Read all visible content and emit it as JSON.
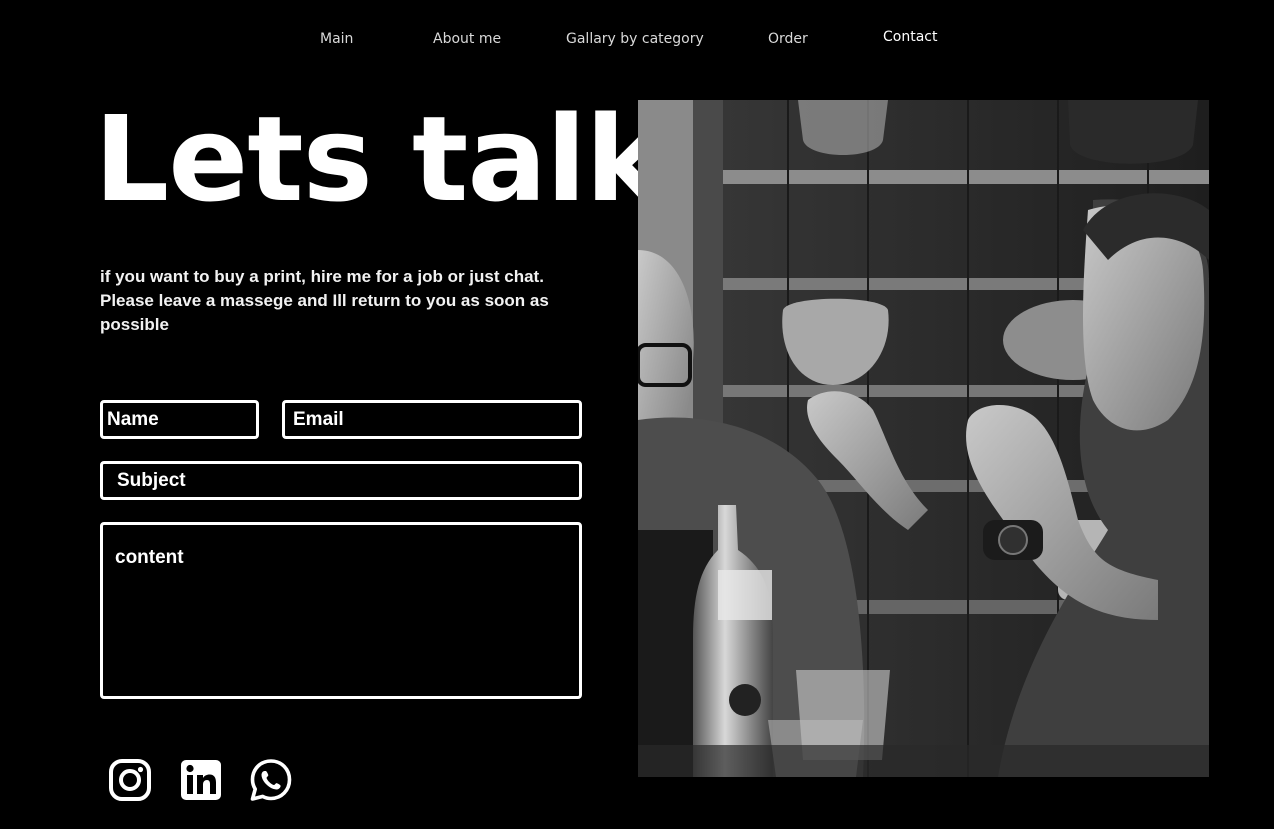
{
  "nav": {
    "items": [
      {
        "label": "Main"
      },
      {
        "label": "About me"
      },
      {
        "label": "Gallary by category"
      },
      {
        "label": "Order"
      },
      {
        "label": "Contact"
      }
    ]
  },
  "hero": {
    "title": "Lets talk",
    "intro": "if you want to buy a print, hire me for a job or just chat. Please leave a massege and Ill return to you as soon as possible"
  },
  "form": {
    "name_placeholder": "Name",
    "email_placeholder": "Email",
    "subject_placeholder": "Subject",
    "content_placeholder": "content"
  },
  "social": {
    "icons": [
      "instagram-icon",
      "linkedin-icon",
      "whatsapp-icon"
    ]
  },
  "photo": {
    "icon": "photo-two-men-at-table",
    "tone": "grayscale"
  },
  "colors": {
    "background": "#000000",
    "text": "#ffffff",
    "nav_text": "#d9d9d9"
  }
}
